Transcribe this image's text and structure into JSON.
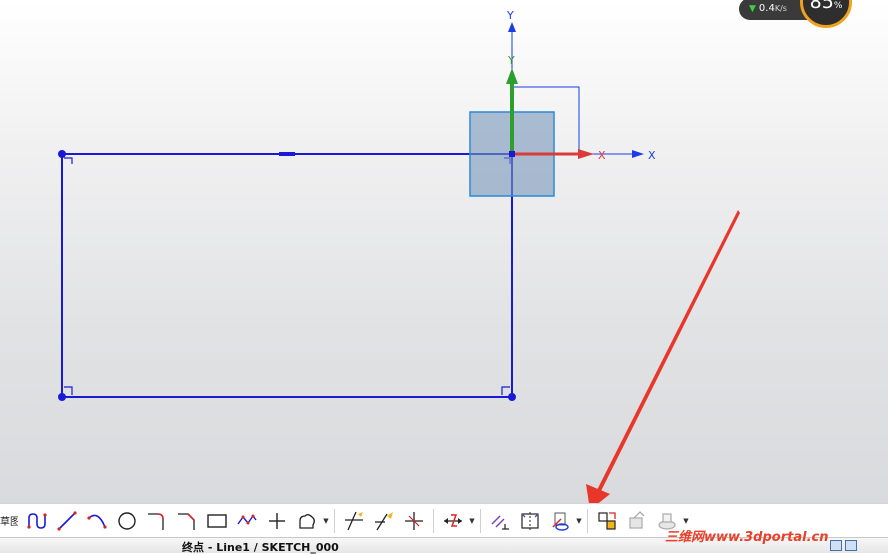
{
  "net_widget": {
    "speed": "0.4",
    "speed_unit": "K/s",
    "percent": "85",
    "percent_sign": "%"
  },
  "axes": {
    "y": "Y",
    "x": "X",
    "x_red": "X",
    "y_green": "Y"
  },
  "toolbar": {
    "title": "草图"
  },
  "statusbar": {
    "text": "终点 - Line1 / SKETCH_000"
  },
  "watermark": {
    "text": "三维网www.3dportal.cn"
  },
  "colors": {
    "sketch_line": "#1a1ad6",
    "x_handle": "#d93a3a",
    "y_handle": "#2e9e2e",
    "annotation_arrow": "#e8362a",
    "marker_fill": "rgba(120,150,185,0.6)"
  }
}
